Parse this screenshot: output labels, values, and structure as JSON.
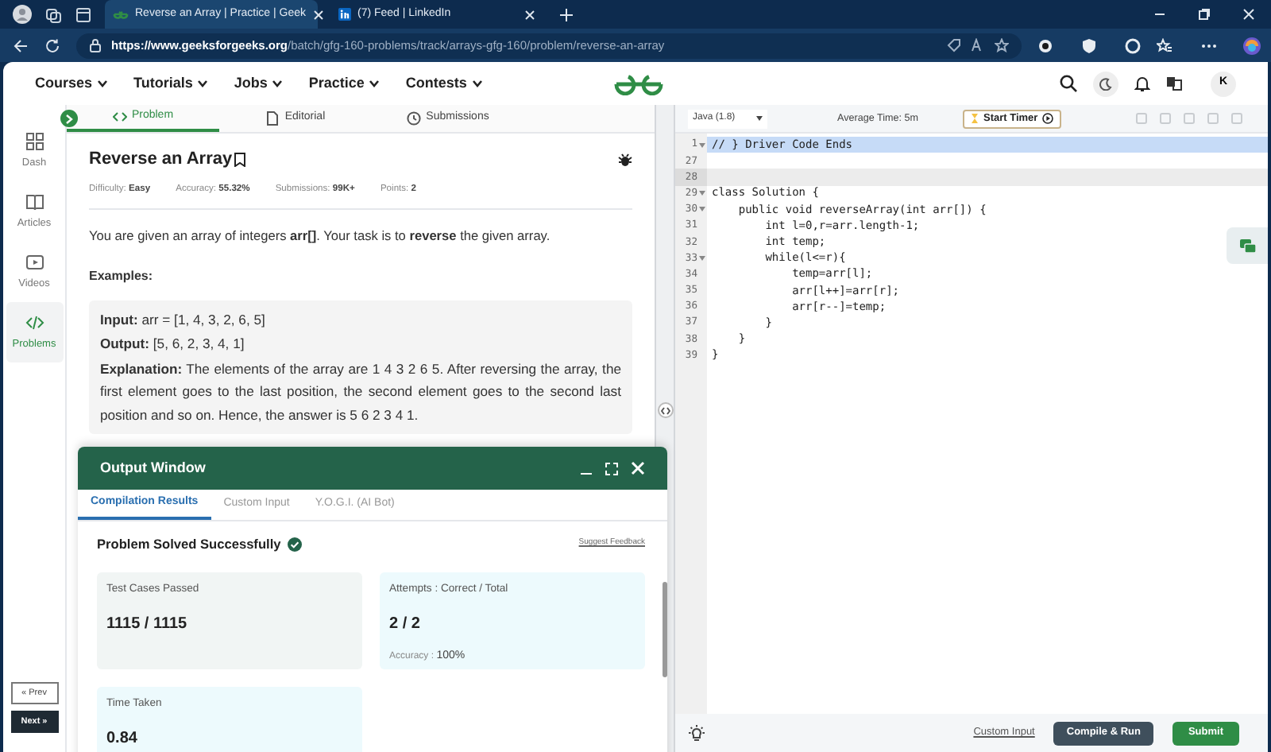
{
  "browser": {
    "tabs": [
      {
        "title": "Reverse an Array | Practice | Geek",
        "selected": true
      },
      {
        "title": "(7) Feed | LinkedIn",
        "selected": false
      }
    ],
    "url_host": "https://www.geeksforgeeks.org",
    "url_path": "/batch/gfg-160-problems/track/arrays-gfg-160/problem/reverse-an-array"
  },
  "site_nav": [
    "Courses",
    "Tutorials",
    "Jobs",
    "Practice",
    "Contests"
  ],
  "avatar": "K",
  "sidebar": {
    "items": [
      {
        "label": "Dash",
        "selected": false
      },
      {
        "label": "Articles",
        "selected": false
      },
      {
        "label": "Videos",
        "selected": false
      },
      {
        "label": "Problems",
        "selected": true
      }
    ],
    "prev": "« Prev",
    "next": "Next »"
  },
  "problem": {
    "tabs": [
      {
        "label": "Problem",
        "selected": true
      },
      {
        "label": "Editorial",
        "selected": false
      },
      {
        "label": "Submissions",
        "selected": false
      }
    ],
    "title": "Reverse an Array",
    "meta": [
      {
        "label": "Difficulty: ",
        "value": "Easy"
      },
      {
        "label": "Accuracy: ",
        "value": "55.32%"
      },
      {
        "label": "Submissions: ",
        "value": "99K+"
      },
      {
        "label": "Points: ",
        "value": "2"
      }
    ],
    "description": "You are given an array of integers **arr[]**. Your task is to **reverse** the given array.",
    "examples_heading": "Examples:",
    "example": [
      "**Input:** arr = [1, 4, 3, 2, 6, 5]",
      "**Output:** [5, 6, 2, 3, 4, 1]",
      "**Explanation:** The elements of the array are 1 4 3 2 6 5. After reversing the array, the first element goes to the last position, the second element goes to the second last position and so on. Hence, the answer is 5 6 2 3 4 1."
    ]
  },
  "output": {
    "title": "Output Window",
    "tabs": [
      {
        "label": "Compilation Results",
        "selected": true
      },
      {
        "label": "Custom Input",
        "selected": false
      },
      {
        "label": "Y.O.G.I. (AI Bot)",
        "selected": false
      }
    ],
    "status": "Problem Solved Successfully",
    "feedback": "Suggest Feedback",
    "cards": [
      {
        "label": "Test Cases Passed",
        "value": "1115 / 1115"
      },
      {
        "label": "Attempts : Correct / Total",
        "value": "2 / 2",
        "note_label": "Accuracy : ",
        "note_value": "100%"
      },
      {
        "label": "Time Taken",
        "value": "0.84"
      }
    ]
  },
  "editor": {
    "language": "Java (1.8)",
    "average_time": "Average Time: 5m",
    "timer": "Start Timer",
    "lines": [
      {
        "num": "1",
        "text": "// } Driver Code Ends",
        "foldable": true,
        "kind": "selection"
      },
      {
        "num": "27",
        "foldable": false,
        "kind": "plain"
      },
      {
        "num": "28",
        "foldable": false,
        "kind": "cursor"
      },
      {
        "num": "29",
        "text": "class Solution {",
        "foldable": true,
        "kind": "plain"
      },
      {
        "num": "30",
        "text": "    public void reverseArray(int arr[]) {",
        "foldable": true,
        "kind": "plain"
      },
      {
        "num": "31",
        "text": "        int l=0,r=arr.length-1;",
        "foldable": false,
        "kind": "plain"
      },
      {
        "num": "32",
        "text": "        int temp;",
        "foldable": false,
        "kind": "plain"
      },
      {
        "num": "33",
        "text": "        while(l<=r){",
        "foldable": true,
        "kind": "plain"
      },
      {
        "num": "34",
        "text": "            temp=arr[l];",
        "foldable": false,
        "kind": "plain"
      },
      {
        "num": "35",
        "text": "            arr[l++]=arr[r];",
        "foldable": false,
        "kind": "plain"
      },
      {
        "num": "36",
        "text": "            arr[r--]=temp;",
        "foldable": false,
        "kind": "plain"
      },
      {
        "num": "37",
        "text": "        }",
        "foldable": false,
        "kind": "plain"
      },
      {
        "num": "38",
        "text": "    }",
        "foldable": false,
        "kind": "plain"
      },
      {
        "num": "39",
        "text": "}",
        "foldable": false,
        "kind": "plain"
      }
    ],
    "custom_input": "Custom Input",
    "compile": "Compile & Run",
    "submit": "Submit"
  }
}
